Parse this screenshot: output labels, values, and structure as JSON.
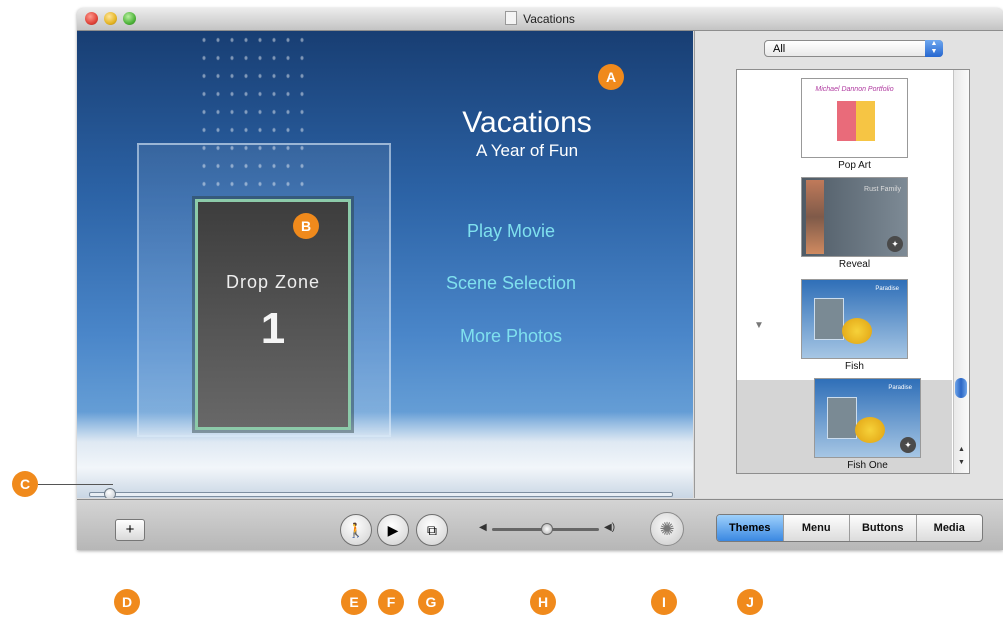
{
  "window": {
    "title": "Vacations"
  },
  "preview": {
    "menu_title": "Vacations",
    "menu_subtitle": "A Year of Fun",
    "buttons": [
      "Play Movie",
      "Scene Selection",
      "More Photos"
    ],
    "drop_zone": {
      "label": "Drop Zone",
      "number": "1"
    }
  },
  "theme_browser": {
    "category": "All",
    "themes": [
      {
        "name": "Pop Art",
        "thumb_text": "Michael Dannon Portfolio"
      },
      {
        "name": "Reveal",
        "thumb_text": "Rust Family"
      },
      {
        "name": "Fish",
        "thumb_text": "Paradise"
      },
      {
        "name": "Fish One",
        "thumb_text": "Paradise"
      }
    ],
    "selected": "Fish One"
  },
  "toolbar": {
    "plus_label": "+",
    "motion_icon": "walking-figure-icon",
    "play_icon": "play-icon",
    "map_icon": "map-icon",
    "burn_icon": "burn-aperture-icon",
    "tabs": [
      "Themes",
      "Menu",
      "Buttons",
      "Media"
    ],
    "active_tab": "Themes"
  },
  "callouts": [
    "A",
    "B",
    "C",
    "D",
    "E",
    "F",
    "G",
    "H",
    "I",
    "J"
  ],
  "colors": {
    "callout": "#f08a1c",
    "menu_button_text": "#7fe0ee",
    "active_tab": "#3a88e2"
  }
}
